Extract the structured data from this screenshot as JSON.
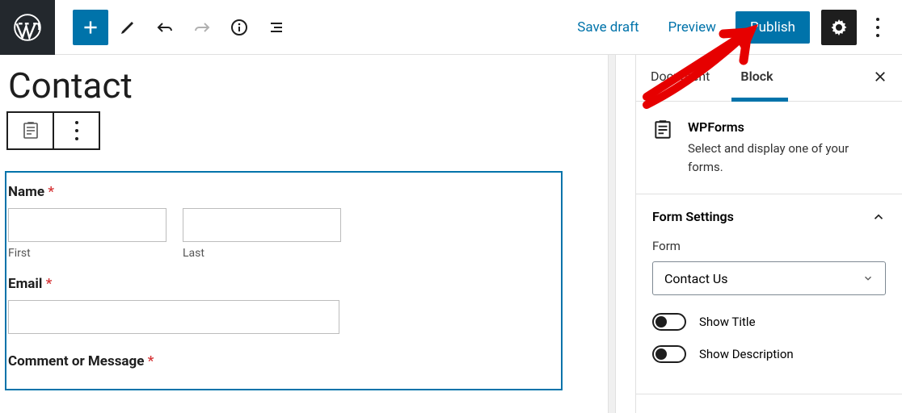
{
  "topbar": {
    "save_draft": "Save draft",
    "preview": "Preview",
    "publish": "Publish"
  },
  "page": {
    "title": "Contact"
  },
  "form": {
    "name_label": "Name",
    "first_sublabel": "First",
    "last_sublabel": "Last",
    "email_label": "Email",
    "comment_label": "Comment or Message",
    "required_mark": "*"
  },
  "sidebar": {
    "tabs": {
      "document": "Document",
      "block": "Block"
    },
    "block_info": {
      "title": "WPForms",
      "desc": "Select and display one of your forms."
    },
    "form_settings": {
      "title": "Form Settings",
      "form_label": "Form",
      "selected_form": "Contact Us",
      "show_title": "Show Title",
      "show_description": "Show Description"
    }
  }
}
